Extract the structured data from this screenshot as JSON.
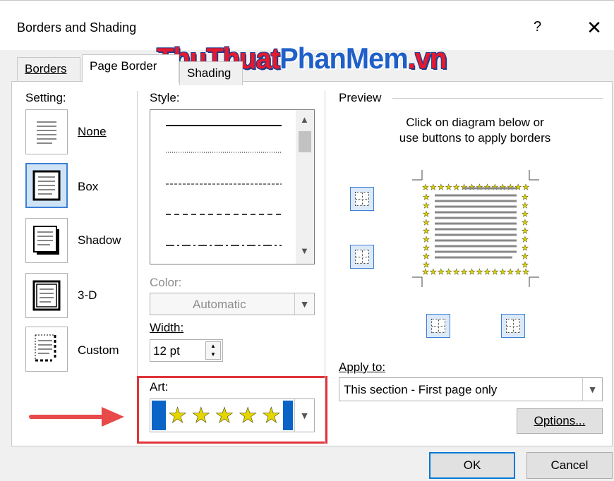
{
  "window": {
    "title": "Borders and Shading",
    "help_label": "?",
    "close_label": "✕"
  },
  "watermark": {
    "part1": "ThuThuat",
    "part2": "PhanMem",
    "part3": ".vn"
  },
  "tabs": [
    {
      "label": "Borders",
      "active": false
    },
    {
      "label": "Page Border",
      "active": true
    },
    {
      "label": "Shading",
      "active": false
    }
  ],
  "setting": {
    "heading": "Setting:",
    "options": [
      {
        "label": "None",
        "selected": false
      },
      {
        "label": "Box",
        "selected": true
      },
      {
        "label": "Shadow",
        "selected": false
      },
      {
        "label": "3-D",
        "selected": false
      },
      {
        "label": "Custom",
        "selected": false
      }
    ]
  },
  "style": {
    "heading": "Style:",
    "line_styles": [
      "solid",
      "dotted",
      "fine-dash",
      "dash",
      "dash-dot"
    ]
  },
  "color": {
    "heading": "Color:",
    "value": "Automatic"
  },
  "width": {
    "heading": "Width:",
    "value": "12 pt"
  },
  "art": {
    "heading": "Art:",
    "star_icon": "★",
    "stars_count": 5
  },
  "preview": {
    "heading": "Preview",
    "instruction_line1": "Click on diagram below or",
    "instruction_line2": "use buttons to apply borders"
  },
  "apply_to": {
    "heading": "Apply to:",
    "value": "This section - First page only"
  },
  "buttons": {
    "options": "Options...",
    "ok": "OK",
    "cancel": "Cancel"
  },
  "colors": {
    "accent": "#0078d7",
    "highlight_box": "#e0343a",
    "arrow": "#e84a4a",
    "star": "#e6d600",
    "art_bar": "#0a64c8"
  }
}
